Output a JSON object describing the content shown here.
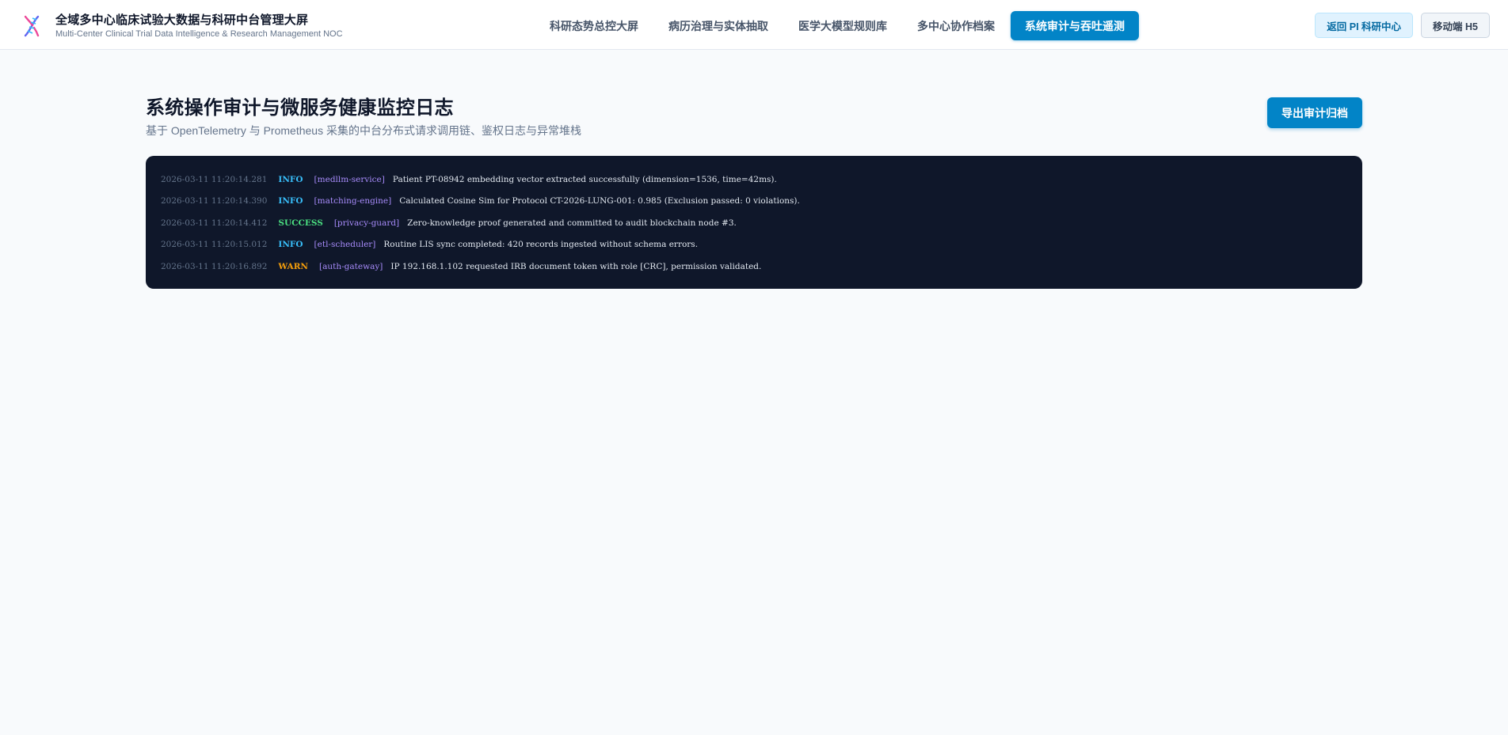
{
  "header": {
    "title": "全域多中心临床试验大数据与科研中台管理大屏",
    "subtitle": "Multi-Center Clinical Trial Data Intelligence & Research Management NOC",
    "logo_icon": "dna-icon",
    "nav": [
      {
        "label": "科研态势总控大屏",
        "active": false
      },
      {
        "label": "病历治理与实体抽取",
        "active": false
      },
      {
        "label": "医学大模型规则库",
        "active": false
      },
      {
        "label": "多中心协作档案",
        "active": false
      },
      {
        "label": "系统审计与吞吐遥测",
        "active": true
      }
    ],
    "return_label": "返回 PI 科研中心",
    "mobile_label": "移动端 H5"
  },
  "main": {
    "title": "系统操作审计与微服务健康监控日志",
    "subtitle": "基于 OpenTelemetry 与 Prometheus 采集的中台分布式请求调用链、鉴权日志与异常堆栈",
    "export_label": "导出审计归档"
  },
  "logs": [
    {
      "time": "2026-03-11 11:20:14.281",
      "level": "INFO",
      "service": "[medllm-service]",
      "message": "Patient PT-08942 embedding vector extracted successfully (dimension=1536, time=42ms)."
    },
    {
      "time": "2026-03-11 11:20:14.390",
      "level": "INFO",
      "service": "[matching-engine]",
      "message": "Calculated Cosine Sim for Protocol CT-2026-LUNG-001: 0.985 (Exclusion passed: 0 violations)."
    },
    {
      "time": "2026-03-11 11:20:14.412",
      "level": "SUCCESS",
      "service": "[privacy-guard]",
      "message": "Zero-knowledge proof generated and committed to audit blockchain node #3."
    },
    {
      "time": "2026-03-11 11:20:15.012",
      "level": "INFO",
      "service": "[etl-scheduler]",
      "message": "Routine LIS sync completed: 420 records ingested without schema errors."
    },
    {
      "time": "2026-03-11 11:20:16.892",
      "level": "WARN",
      "service": "[auth-gateway]",
      "message": "IP 192.168.1.102 requested IRB document token with role [CRC], permission validated."
    }
  ],
  "colors": {
    "accent": "#0284c7",
    "terminal_bg": "#0f172a",
    "info": "#38bdf8",
    "success": "#4ade80",
    "warn": "#f59e0b",
    "service": "#a78bfa"
  }
}
